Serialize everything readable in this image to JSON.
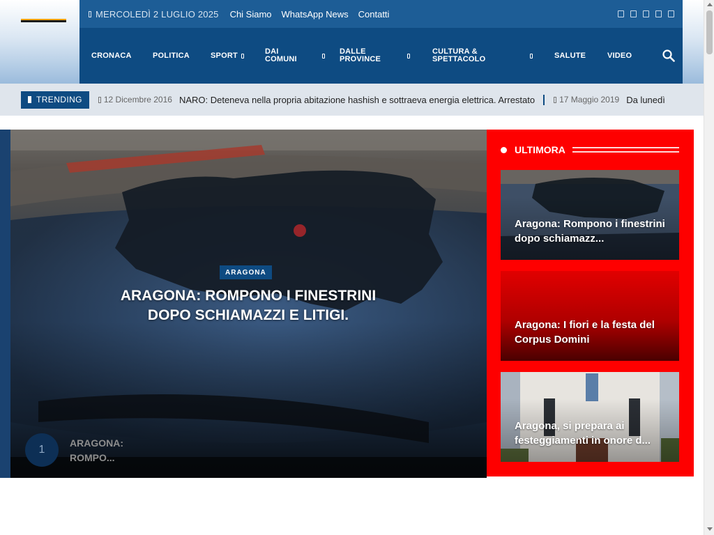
{
  "topbar": {
    "date": "MERCOLEDÌ 2 LUGLIO 2025",
    "links": [
      "Chi Siamo",
      "WhatsApp News",
      "Contatti"
    ],
    "socials": [
      "facebook-icon",
      "twitter-icon",
      "instagram-icon",
      "youtube-icon",
      "rss-icon"
    ]
  },
  "nav": {
    "cronaca": "CRONACA",
    "politica": "POLITICA",
    "sport": "SPORT",
    "dai_comuni": [
      "DAI",
      "COMUNI"
    ],
    "dalle_province": [
      "DALLE",
      "PROVINCE"
    ],
    "cultura": [
      "CULTURA &",
      "SPETTACOLO"
    ],
    "salute": "SALUTE",
    "video": "VIDEO"
  },
  "trending": {
    "label": "TRENDING",
    "items": [
      {
        "date": "12 Dicembre 2016",
        "title": "NARO:  Deteneva nella propria abitazione hashish e sottraeva energia elettrica. Arrestato"
      },
      {
        "date": "17 Maggio 2019",
        "title": "Da lunedì"
      }
    ]
  },
  "hero": {
    "category": "ARAGONA",
    "title": "ARAGONA: ROMPONO I FINESTRINI DOPO SCHIAMAZZI E LITIGI.",
    "number": "1",
    "mini_title": "ARAGONA: ROMPO..."
  },
  "ultimora": {
    "label": "ULTIMORA",
    "cards": [
      {
        "title": "Aragona: Rompono i finestrini dopo schiamazz..."
      },
      {
        "title": "Aragona: I fiori e la festa del Corpus Domini"
      },
      {
        "title": "Aragona, si prepara ai festeggiamenti in onore d..."
      }
    ]
  },
  "colors": {
    "nav_blue": "#0e4b82",
    "topbar_blue": "#1d5d96",
    "ultimora_red": "#fe0000"
  }
}
